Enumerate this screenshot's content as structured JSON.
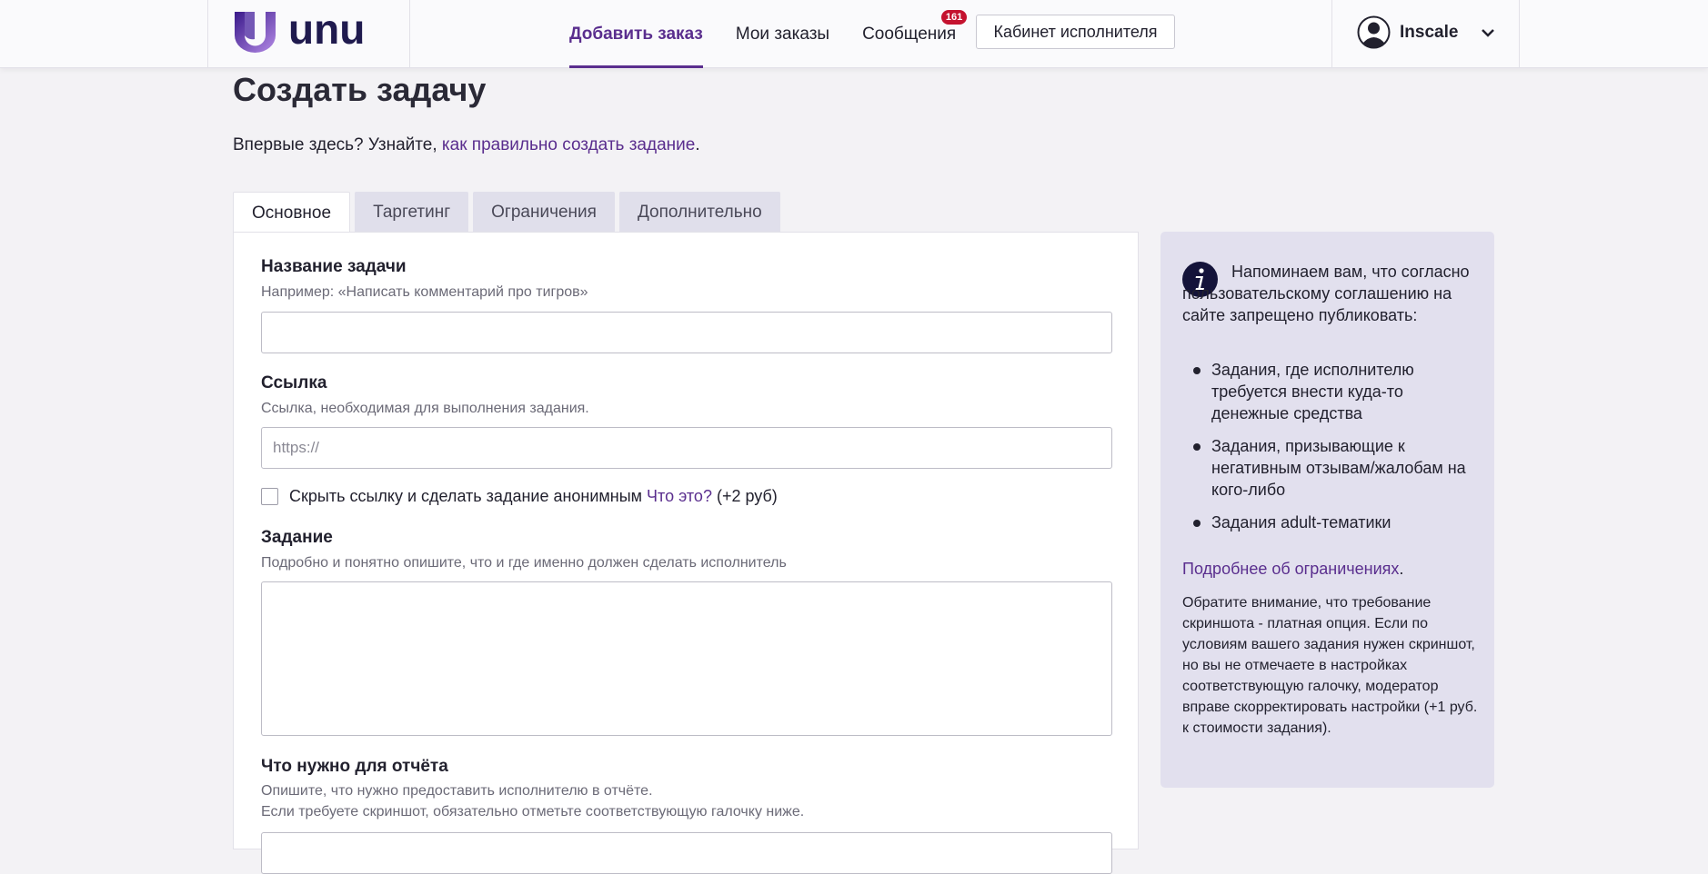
{
  "header": {
    "logo_text": "unu",
    "nav": [
      {
        "label": "Добавить заказ",
        "active": true
      },
      {
        "label": "Мои заказы",
        "active": false
      },
      {
        "label": "Сообщения",
        "active": false,
        "badge": "161"
      }
    ],
    "cabinet_button": "Кабинет исполнителя",
    "user_name": "Inscale"
  },
  "page": {
    "title": "Создать задачу",
    "intro_prefix": "Впервые здесь? Узнайте, ",
    "intro_link": "как правильно создать задание",
    "intro_suffix": "."
  },
  "tabs": [
    {
      "label": "Основное",
      "active": true
    },
    {
      "label": "Таргетинг",
      "active": false
    },
    {
      "label": "Ограничения",
      "active": false
    },
    {
      "label": "Дополнительно",
      "active": false
    }
  ],
  "form": {
    "task_name": {
      "label": "Название задачи",
      "hint": "Например: «Написать комментарий про тигров»",
      "value": ""
    },
    "link": {
      "label": "Ссылка",
      "hint": "Ссылка, необходимая для выполнения задания.",
      "placeholder": "https://"
    },
    "anonymous": {
      "label": "Скрыть ссылку и сделать задание анонимным",
      "link": "Что это?",
      "price": "(+2 руб)",
      "checked": false
    },
    "task": {
      "label": "Задание",
      "hint": "Подробно и понятно опишите, что и где именно должен сделать исполнитель"
    },
    "report": {
      "label": "Что нужно для отчёта",
      "hint_line1": "Опишите, что нужно предоставить исполнителю в отчёте.",
      "hint_line2": "Если требуете скриншот, обязательно отметьте соответствующую галочку ниже."
    }
  },
  "notice": {
    "intro": "Напоминаем вам, что согласно пользовательскому соглашению на сайте запрещено публиковать:",
    "items": [
      "Задания, где исполнителю требуется внести куда-то денежные средства",
      "Задания, призывающие к негативным отзывам/жалобам на кого-либо",
      "Задания adult-тематики"
    ],
    "more_link": "Подробнее об ограничениях",
    "more_suffix": ".",
    "note": "Обратите внимание, что требование скриншота - платная опция. Если по условиям вашего задания нужен скриншот, но вы не отмечаете в настройках соответствующую галочку, модератор вправе скорректировать настройки (+1 руб. к стоимости задания)."
  },
  "colors": {
    "brand": "#5a2e8e",
    "badge": "#c4122f",
    "notice_bg": "#e2e0ee"
  }
}
